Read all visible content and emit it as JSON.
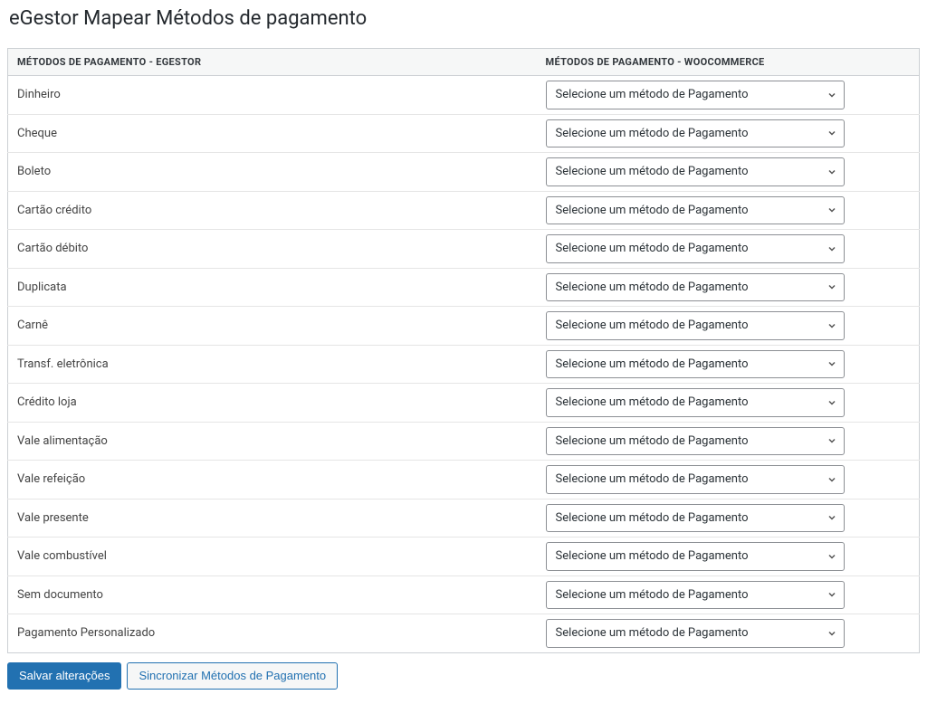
{
  "page_title": "eGestor Mapear Métodos de pagamento",
  "table": {
    "headers": {
      "egestor": "Métodos de pagamento - eGestor",
      "woocommerce": "Métodos de pagamento - WooCommerce"
    },
    "placeholder": "Selecione um método de Pagamento",
    "rows": [
      {
        "label": "Dinheiro"
      },
      {
        "label": "Cheque"
      },
      {
        "label": "Boleto"
      },
      {
        "label": "Cartão crédito"
      },
      {
        "label": "Cartão débito"
      },
      {
        "label": "Duplicata"
      },
      {
        "label": "Carnê"
      },
      {
        "label": "Transf. eletrônica"
      },
      {
        "label": "Crédito loja"
      },
      {
        "label": "Vale alimentação"
      },
      {
        "label": "Vale refeição"
      },
      {
        "label": "Vale presente"
      },
      {
        "label": "Vale combustível"
      },
      {
        "label": "Sem documento"
      },
      {
        "label": "Pagamento Personalizado"
      }
    ]
  },
  "buttons": {
    "save": "Salvar alterações",
    "sync": "Sincronizar Métodos de Pagamento"
  }
}
